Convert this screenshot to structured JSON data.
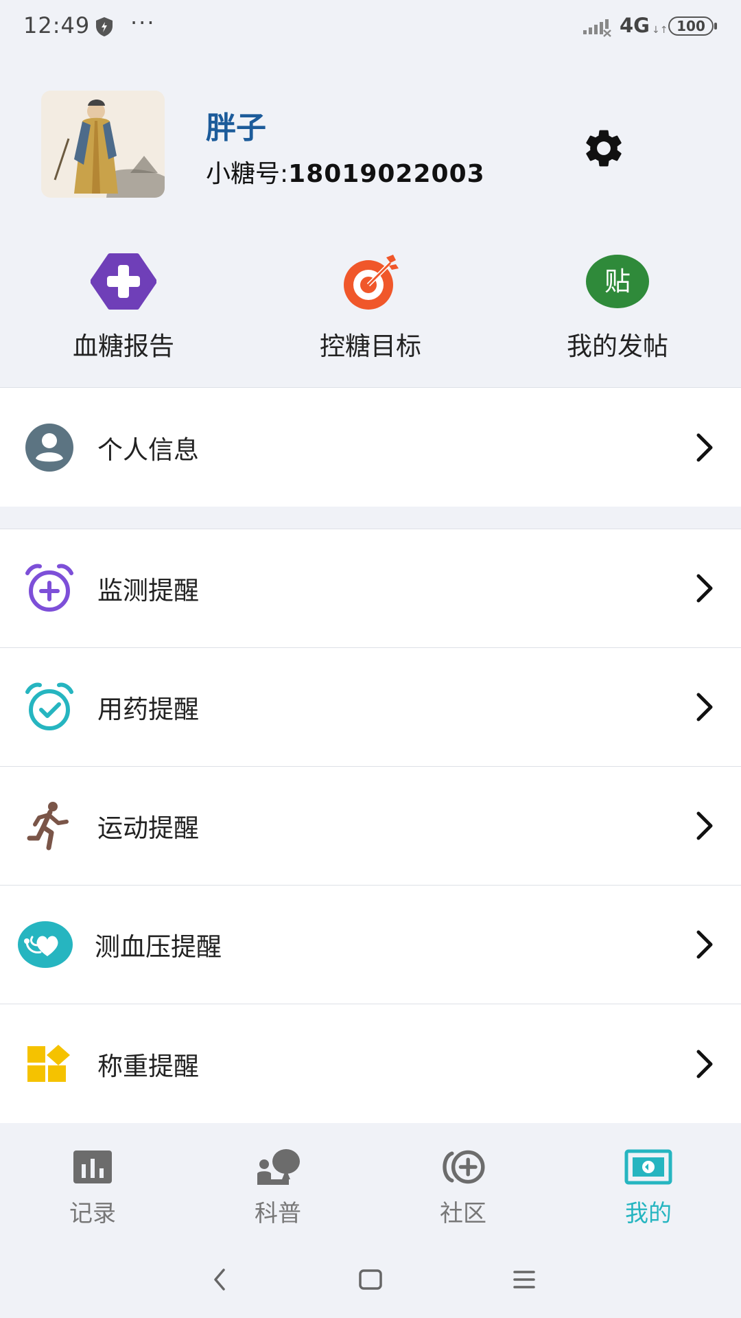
{
  "status_bar": {
    "time": "12:49",
    "dots": "···",
    "network": "4G",
    "network_arrows": "↓↑",
    "battery": "100"
  },
  "profile": {
    "name": "胖子",
    "id_label": "小糖号:",
    "id_value": "18019022003"
  },
  "quick_actions": [
    {
      "label": "血糖报告",
      "icon": "medical-cross-icon",
      "color": "#6f3fb8"
    },
    {
      "label": "控糖目标",
      "icon": "target-icon",
      "color": "#f0572a"
    },
    {
      "label": "我的发帖",
      "icon": "post-icon",
      "color": "#2f8a3a",
      "glyph": "贴"
    }
  ],
  "menu": {
    "personal": {
      "label": "个人信息",
      "icon": "user-icon",
      "color": "#5c7482"
    },
    "reminders": [
      {
        "label": "监测提醒",
        "icon": "alarm-plus-icon",
        "color": "#7d4fd8"
      },
      {
        "label": "用药提醒",
        "icon": "alarm-check-icon",
        "color": "#26b5c0"
      },
      {
        "label": "运动提醒",
        "icon": "runner-icon",
        "color": "#7a5548"
      },
      {
        "label": "测血压提醒",
        "icon": "heart-pulse-icon",
        "color": "#26b5c0"
      },
      {
        "label": "称重提醒",
        "icon": "blocks-icon",
        "color": "#f5c200"
      }
    ]
  },
  "bottom_nav": {
    "active_color": "#26b5c0",
    "items": [
      {
        "label": "记录",
        "icon": "bar-chart-icon"
      },
      {
        "label": "科普",
        "icon": "reading-icon"
      },
      {
        "label": "社区",
        "icon": "community-plus-icon"
      },
      {
        "label": "我的",
        "icon": "profile-card-icon",
        "active": true
      }
    ]
  }
}
